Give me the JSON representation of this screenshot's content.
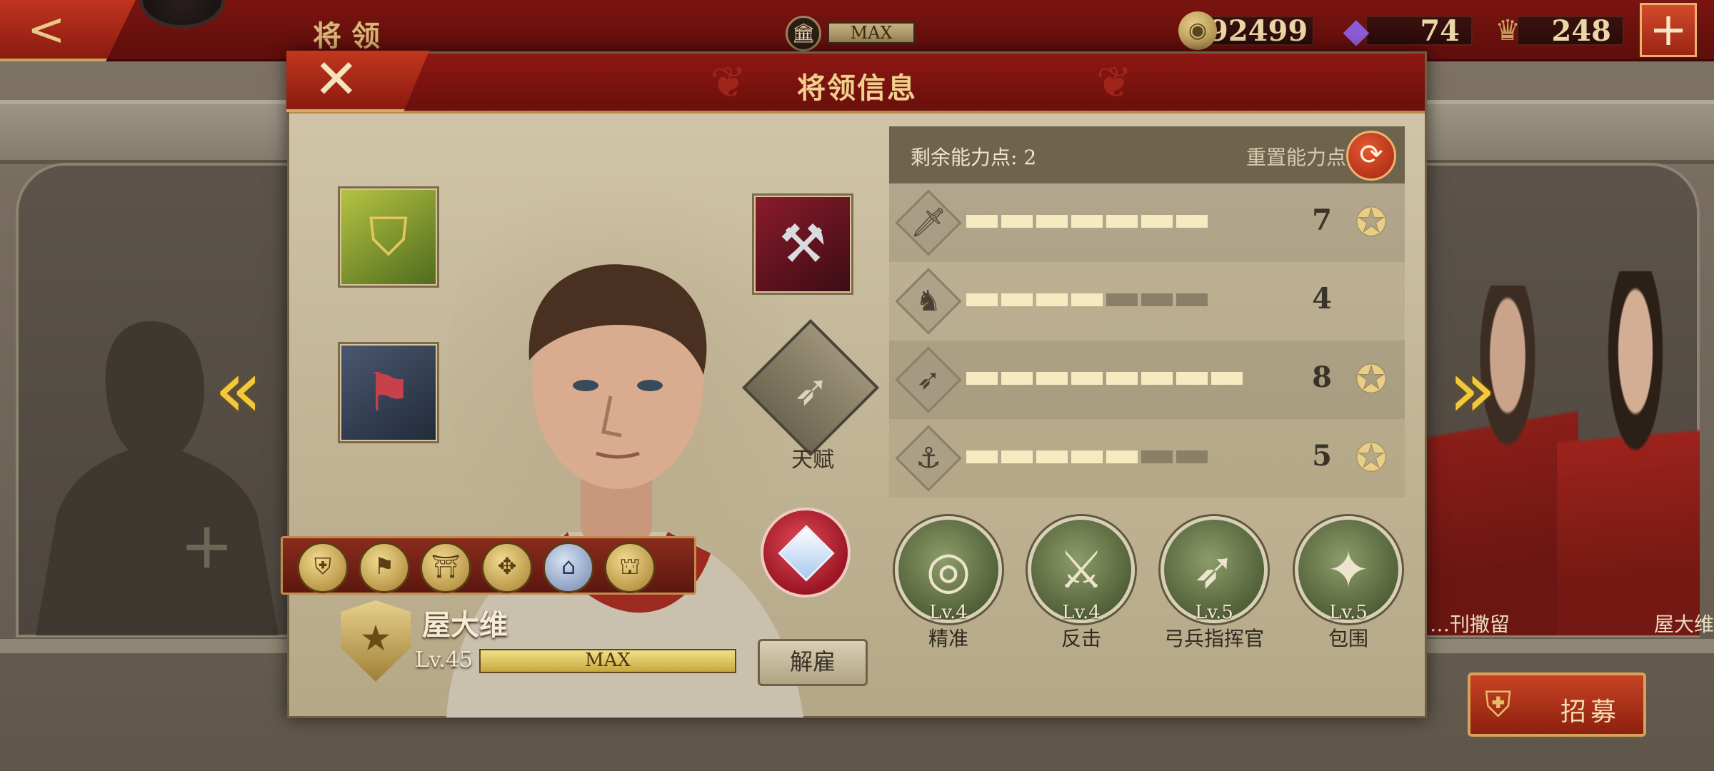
{
  "topbar": {
    "title": "将领",
    "building_level": "MAX",
    "resources": [
      {
        "name": "coins",
        "icon": "coin-icon",
        "value": "92499"
      },
      {
        "name": "gems",
        "icon": "gem-icon",
        "value": "74"
      },
      {
        "name": "laurel",
        "icon": "laurel-badge-icon",
        "value": "248"
      }
    ],
    "plus": "+"
  },
  "background": {
    "heroes": [
      "…刊撒留",
      "屋大维"
    ]
  },
  "dialog": {
    "title": "将领信息",
    "close": "✕",
    "talent_label": "天赋",
    "hero": {
      "name": "屋大维",
      "level": "Lv.45",
      "xp_label": "MAX",
      "dismiss": "解雇"
    },
    "points": {
      "remaining_label": "剩余能力点: 2",
      "reset_label": "重置能力点"
    },
    "stats": [
      {
        "name": "infantry",
        "icon": "sword-icon",
        "glyph": "🗡",
        "value": "7",
        "max": 10,
        "filled": 7,
        "medal": true
      },
      {
        "name": "cavalry",
        "icon": "horse-icon",
        "glyph": "♞",
        "value": "4",
        "max": 10,
        "filled": 4,
        "medal": false
      },
      {
        "name": "archery",
        "icon": "bow-icon",
        "glyph": "➶",
        "value": "8",
        "max": 10,
        "filled": 8,
        "medal": true
      },
      {
        "name": "navy",
        "icon": "anchor-icon",
        "glyph": "⚓",
        "value": "5",
        "max": 10,
        "filled": 5,
        "medal": true
      }
    ],
    "skills": [
      {
        "level": "Lv.4",
        "name": "精准",
        "icon": "target-icon",
        "glyph": "◎"
      },
      {
        "level": "Lv.4",
        "name": "反击",
        "icon": "duel-icon",
        "glyph": "⚔"
      },
      {
        "level": "Lv.5",
        "name": "弓兵指挥官",
        "icon": "bow-icon",
        "glyph": "➶"
      },
      {
        "level": "Lv.5",
        "name": "包围",
        "icon": "encircle-icon",
        "glyph": "✦"
      }
    ]
  },
  "recruit": {
    "label": "招募"
  },
  "colors": {
    "header_red": "#7a1410",
    "gold": "#efd08e",
    "panel": "#c2b596",
    "stat_bar": "#f6eac0"
  }
}
